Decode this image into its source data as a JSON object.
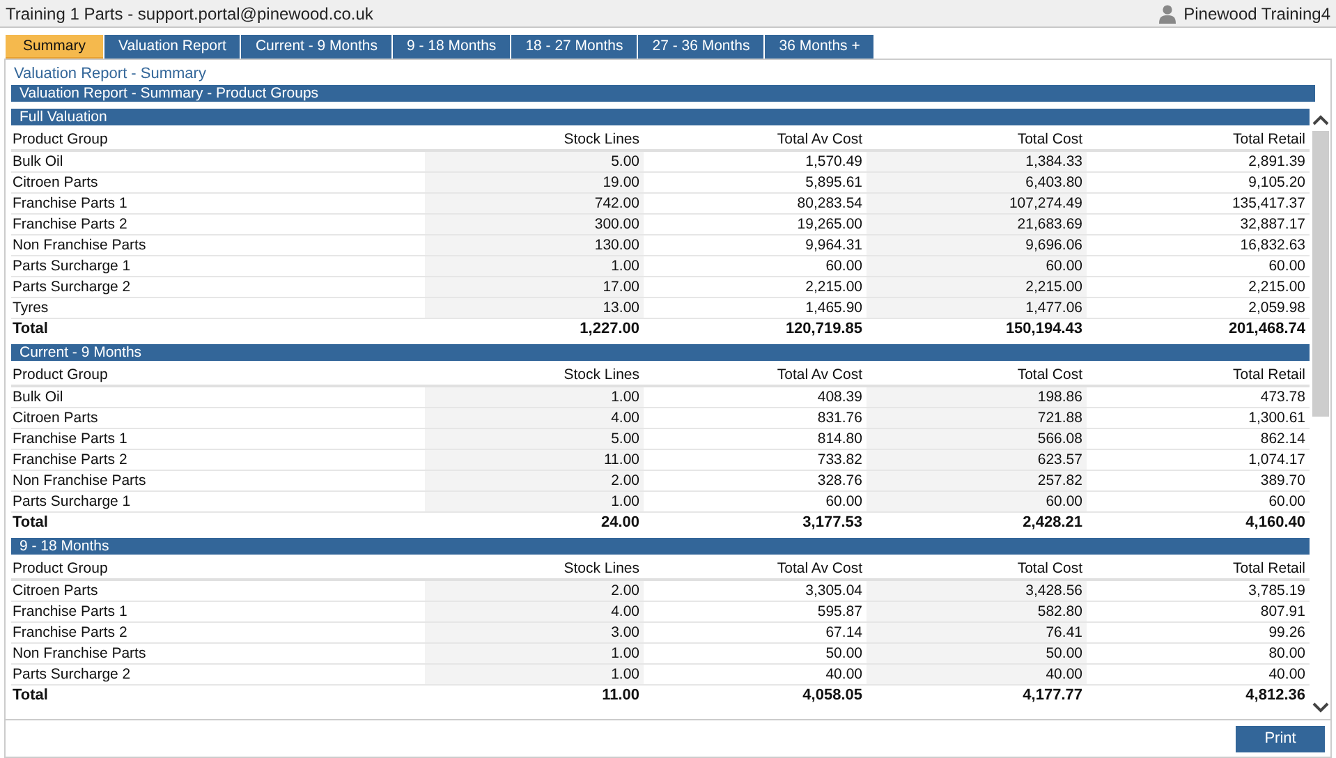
{
  "window": {
    "title": "Training 1 Parts - support.portal@pinewood.co.uk",
    "user": "Pinewood Training4"
  },
  "tabs": [
    {
      "label": "Summary",
      "selected": true
    },
    {
      "label": "Valuation Report",
      "selected": false
    },
    {
      "label": "Current - 9 Months",
      "selected": false
    },
    {
      "label": "9 - 18 Months",
      "selected": false
    },
    {
      "label": "18 - 27 Months",
      "selected": false
    },
    {
      "label": "27 - 36 Months",
      "selected": false
    },
    {
      "label": "36 Months +",
      "selected": false
    }
  ],
  "page_title": "Valuation Report - Summary",
  "report_bar": "Valuation Report - Summary - Product Groups",
  "sections": [
    {
      "title": "Full Valuation",
      "columns": [
        "Product Group",
        "Stock Lines",
        "Total Av Cost",
        "Total Cost",
        "Total Retail"
      ],
      "rows": [
        [
          "Bulk Oil",
          "5.00",
          "1,570.49",
          "1,384.33",
          "2,891.39"
        ],
        [
          "Citroen Parts",
          "19.00",
          "5,895.61",
          "6,403.80",
          "9,105.20"
        ],
        [
          "Franchise Parts 1",
          "742.00",
          "80,283.54",
          "107,274.49",
          "135,417.37"
        ],
        [
          "Franchise Parts 2",
          "300.00",
          "19,265.00",
          "21,683.69",
          "32,887.17"
        ],
        [
          "Non Franchise Parts",
          "130.00",
          "9,964.31",
          "9,696.06",
          "16,832.63"
        ],
        [
          "Parts Surcharge 1",
          "1.00",
          "60.00",
          "60.00",
          "60.00"
        ],
        [
          "Parts Surcharge 2",
          "17.00",
          "2,215.00",
          "2,215.00",
          "2,215.00"
        ],
        [
          "Tyres",
          "13.00",
          "1,465.90",
          "1,477.06",
          "2,059.98"
        ]
      ],
      "total": [
        "Total",
        "1,227.00",
        "120,719.85",
        "150,194.43",
        "201,468.74"
      ]
    },
    {
      "title": "Current - 9 Months",
      "columns": [
        "Product Group",
        "Stock Lines",
        "Total Av Cost",
        "Total Cost",
        "Total Retail"
      ],
      "rows": [
        [
          "Bulk Oil",
          "1.00",
          "408.39",
          "198.86",
          "473.78"
        ],
        [
          "Citroen Parts",
          "4.00",
          "831.76",
          "721.88",
          "1,300.61"
        ],
        [
          "Franchise Parts 1",
          "5.00",
          "814.80",
          "566.08",
          "862.14"
        ],
        [
          "Franchise Parts 2",
          "11.00",
          "733.82",
          "623.57",
          "1,074.17"
        ],
        [
          "Non Franchise Parts",
          "2.00",
          "328.76",
          "257.82",
          "389.70"
        ],
        [
          "Parts Surcharge 1",
          "1.00",
          "60.00",
          "60.00",
          "60.00"
        ]
      ],
      "total": [
        "Total",
        "24.00",
        "3,177.53",
        "2,428.21",
        "4,160.40"
      ]
    },
    {
      "title": "9 - 18 Months",
      "columns": [
        "Product Group",
        "Stock Lines",
        "Total Av Cost",
        "Total Cost",
        "Total Retail"
      ],
      "rows": [
        [
          "Citroen Parts",
          "2.00",
          "3,305.04",
          "3,428.56",
          "3,785.19"
        ],
        [
          "Franchise Parts 1",
          "4.00",
          "595.87",
          "582.80",
          "807.91"
        ],
        [
          "Franchise Parts 2",
          "3.00",
          "67.14",
          "76.41",
          "99.26"
        ],
        [
          "Non Franchise Parts",
          "1.00",
          "50.00",
          "50.00",
          "80.00"
        ],
        [
          "Parts Surcharge 2",
          "1.00",
          "40.00",
          "40.00",
          "40.00"
        ]
      ],
      "total": [
        "Total",
        "11.00",
        "4,058.05",
        "4,177.77",
        "4,812.36"
      ]
    }
  ],
  "buttons": [
    "Print"
  ]
}
